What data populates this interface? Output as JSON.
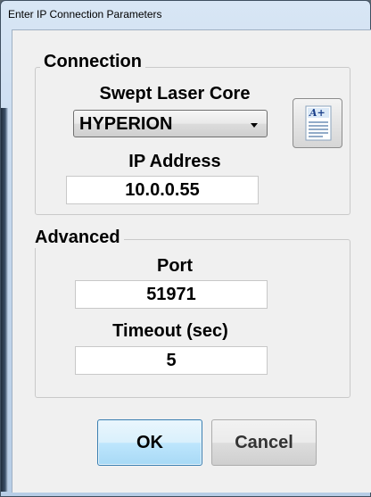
{
  "window": {
    "title": "Enter IP Connection Parameters"
  },
  "connection": {
    "legend": "Connection",
    "core_label": "Swept Laser Core",
    "core_value": "HYPERION",
    "ip_label": "IP Address",
    "ip_value": "10.0.0.55",
    "font_button_icon": "font-style-icon",
    "font_button_glyph": "A+"
  },
  "advanced": {
    "legend": "Advanced",
    "port_label": "Port",
    "port_value": "51971",
    "timeout_label": "Timeout (sec)",
    "timeout_value": "5"
  },
  "buttons": {
    "ok": "OK",
    "cancel": "Cancel"
  }
}
